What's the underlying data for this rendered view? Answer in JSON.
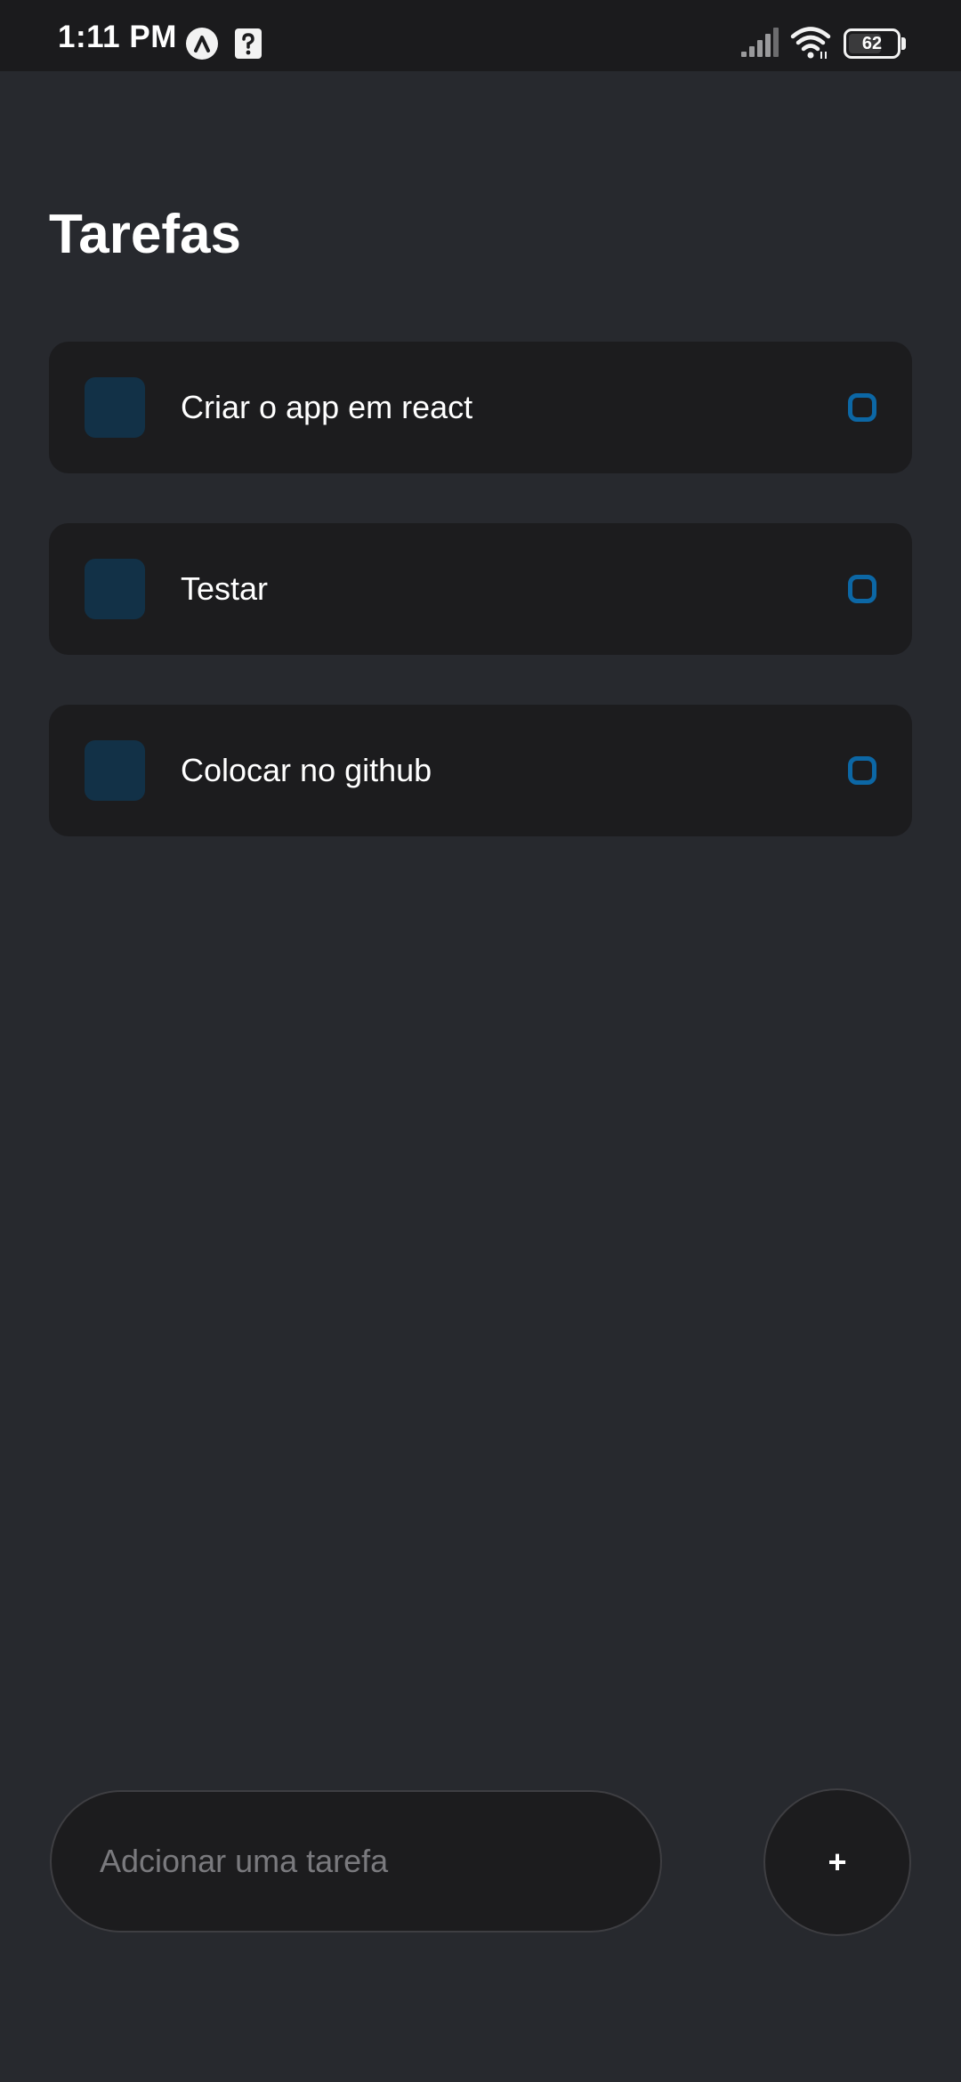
{
  "status_bar": {
    "time": "1:11 PM",
    "battery_level": "62",
    "icons": [
      "expo-app-icon",
      "help-icon",
      "signal-icon",
      "wifi-icon",
      "battery-icon"
    ]
  },
  "header": {
    "title": "Tarefas"
  },
  "tasks": [
    {
      "label": "Criar o app em react"
    },
    {
      "label": "Testar"
    },
    {
      "label": "Colocar no github"
    }
  ],
  "composer": {
    "placeholder": "Adcionar uma tarefa",
    "value": "",
    "add_label": "+"
  },
  "colors": {
    "background": "#27292e",
    "card": "#1c1c1e",
    "task_square": "#123147",
    "accent": "#0c67a5",
    "placeholder": "#7a7a7e"
  }
}
